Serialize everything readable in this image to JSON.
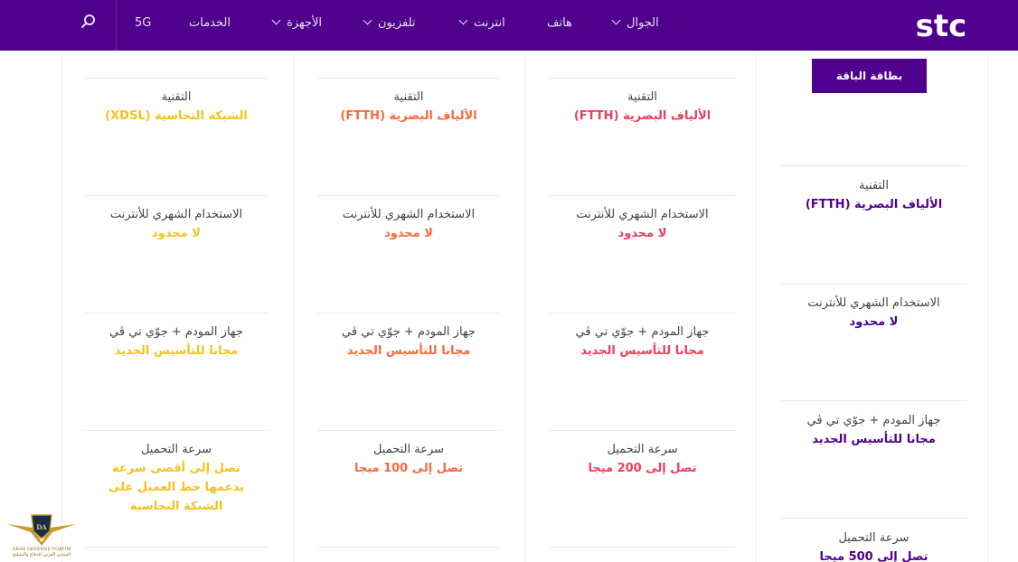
{
  "header": {
    "logo_text": "stc",
    "nav": [
      {
        "label": "الجوال",
        "dropdown": true
      },
      {
        "label": "هاتف",
        "dropdown": false
      },
      {
        "label": "انترنت",
        "dropdown": true
      },
      {
        "label": "تلفزيون",
        "dropdown": true
      },
      {
        "label": "الأجهزة",
        "dropdown": true
      },
      {
        "label": "الخدمات",
        "dropdown": false
      },
      {
        "label": "5G",
        "dropdown": false
      }
    ]
  },
  "plan_card_button": "بطاقة الباقة",
  "plans": [
    {
      "accent": "#4f008c",
      "technology_label": "التقنية",
      "technology": "الألياف البصرية (FTTH)",
      "usage_label": "الاستخدام الشهري للأنترنت",
      "usage": "لا محدود",
      "device_label": "جهاز المودم + جوّي تي ڤي",
      "device": "مجانا للتأسيس الجديد",
      "speed_label": "سرعة التحميل",
      "speed": "تصل إلى 500 ميجا"
    },
    {
      "accent": "#f03c5a",
      "technology_label": "التقنية",
      "technology": "الألياف البصرية (FTTH)",
      "usage_label": "الاستخدام الشهري للأنترنت",
      "usage": "لا محدود",
      "device_label": "جهاز المودم + جوّي تي ڤي",
      "device": "مجانا للتأسيس الجديد",
      "speed_label": "سرعة التحميل",
      "speed": "تصل إلى 200 ميجا"
    },
    {
      "accent": "#f9683a",
      "technology_label": "التقنية",
      "technology": "الألياف البصرية (FTTH)",
      "usage_label": "الاستخدام الشهري للأنترنت",
      "usage": "لا محدود",
      "device_label": "جهاز المودم + جوّي تي ڤي",
      "device": "مجانا للتأسيس الجديد",
      "speed_label": "سرعة التحميل",
      "speed": "تصل إلى 100 ميجا"
    },
    {
      "accent": "#f8c21c",
      "technology_label": "التقنية",
      "technology": "الشبكة النحاسية (XDSL)",
      "usage_label": "الاستخدام الشهري للأنترنت",
      "usage": "لا محدود",
      "device_label": "جهاز المودم + جوّي تي ڤي",
      "device": "مجانا للتأسيس الجديد",
      "speed_label": "سرعة التحميل",
      "speed": "تصل إلى أقصى سرعة يدعمها خط العميل على الشبكة النحاسية"
    }
  ],
  "watermark": {
    "line1": "ARAB DEFENSE FORUM",
    "line2": "المنتدى العربي للدفاع والتسليح"
  }
}
